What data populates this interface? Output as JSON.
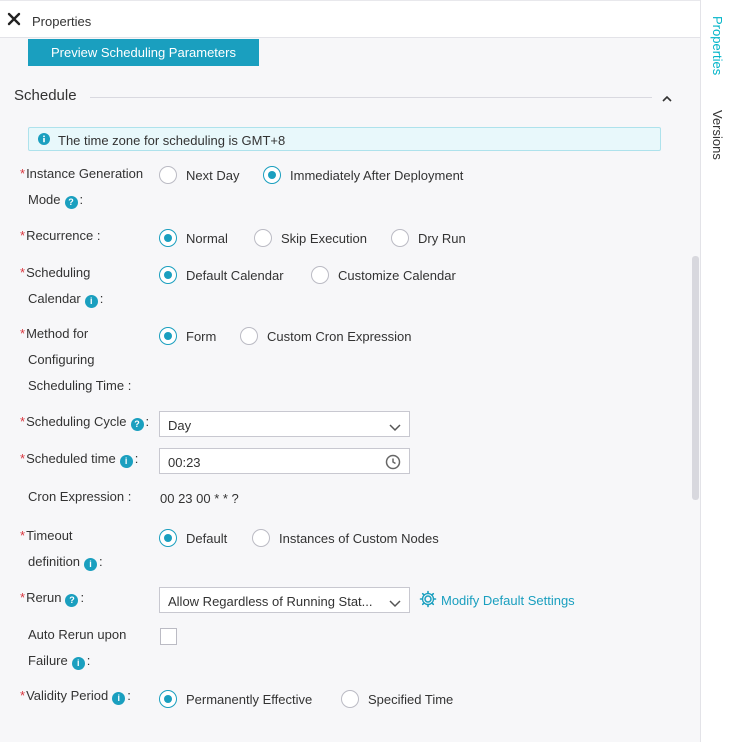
{
  "panel": {
    "title": "Properties"
  },
  "right_rail": {
    "tabs": [
      {
        "label": "Properties",
        "active": true
      },
      {
        "label": "Versions",
        "active": false
      }
    ]
  },
  "preview_button": "Preview Scheduling Parameters",
  "section": {
    "title": "Schedule"
  },
  "info_banner": "The time zone for scheduling is GMT+8",
  "fields": {
    "instance_generation": {
      "label_line1": "Instance Generation",
      "label_line2": "Mode",
      "colon": ":",
      "options": [
        "Next Day",
        "Immediately After Deployment"
      ],
      "selected": "Immediately After Deployment"
    },
    "recurrence": {
      "label": "Recurrence :",
      "options": [
        "Normal",
        "Skip Execution",
        "Dry Run"
      ],
      "selected": "Normal"
    },
    "scheduling_calendar": {
      "label_line1": "Scheduling",
      "label_line2": "Calendar",
      "colon": ":",
      "options": [
        "Default Calendar",
        "Customize Calendar"
      ],
      "selected": "Default Calendar"
    },
    "method": {
      "label_line1": "Method for",
      "label_line2": "Configuring",
      "label_line3": "Scheduling Time :",
      "options": [
        "Form",
        "Custom Cron Expression"
      ],
      "selected": "Form"
    },
    "scheduling_cycle": {
      "label": "Scheduling Cycle",
      "colon": ":",
      "value": "Day"
    },
    "scheduled_time": {
      "label": "Scheduled time",
      "colon": ":",
      "value": "00:23"
    },
    "cron_expression": {
      "label": "Cron Expression :",
      "value": "00 23 00 * * ?"
    },
    "timeout": {
      "label_line1": "Timeout",
      "label_line2": "definition",
      "colon": ":",
      "options": [
        "Default",
        "Instances of Custom Nodes"
      ],
      "selected": "Default"
    },
    "rerun": {
      "label": "Rerun",
      "colon": ":",
      "value": "Allow Regardless of Running Stat...",
      "link": "Modify Default Settings"
    },
    "auto_rerun": {
      "label_line1": "Auto Rerun upon",
      "label_line2": "Failure",
      "colon": ":",
      "checked": false
    },
    "validity_period": {
      "label": "Validity Period",
      "colon": ":",
      "options": [
        "Permanently Effective",
        "Specified Time"
      ],
      "selected": "Permanently Effective"
    }
  },
  "colors": {
    "accent": "#1a9fbf",
    "required": "#d9363e",
    "rail_active": "#00b4c8"
  },
  "icons": {
    "close": "close-icon",
    "collapse": "chevron-up-icon",
    "info": "info-icon",
    "help": "help-icon",
    "dropdown": "chevron-down-icon",
    "clock": "clock-icon",
    "settings": "gear-icon"
  }
}
